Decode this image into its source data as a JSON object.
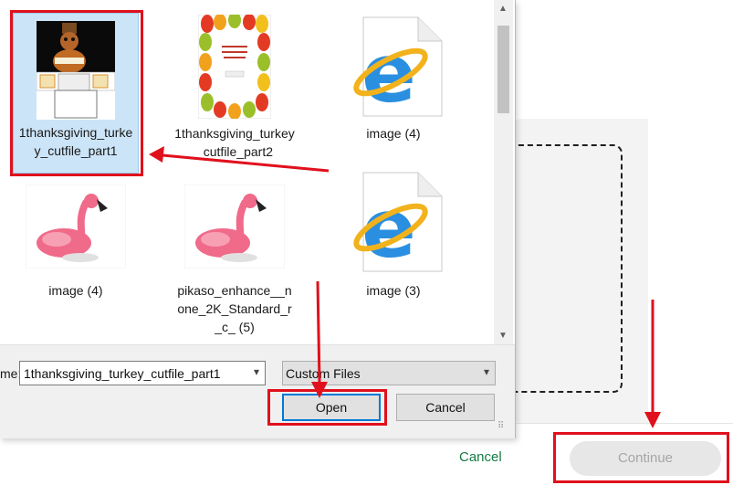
{
  "background": {
    "cancel_label": "Cancel",
    "continue_label": "Continue",
    "accent_color": "#167a45"
  },
  "dialog": {
    "files": [
      {
        "label": "1thanksgiving_turkey_cutfile_part1",
        "icon": "turkey-cutfile-thumbnail",
        "selected": true
      },
      {
        "label": "1thanksgiving_turkey_cutfile_part2",
        "icon": "leaf-wreath-thumbnail",
        "selected": false
      },
      {
        "label": "image (4)",
        "icon": "internet-explorer-file-icon",
        "selected": false
      },
      {
        "label": "image (4)",
        "icon": "flamingo-thumbnail",
        "selected": false
      },
      {
        "label": "pikaso_enhance__none_2K_Standard_r_c_ (5)",
        "icon": "flamingo-thumbnail",
        "selected": false
      },
      {
        "label": "image (3)",
        "icon": "internet-explorer-file-icon",
        "selected": false
      }
    ],
    "file_name_label": "me:",
    "file_name_value": "1thanksgiving_turkey_cutfile_part1",
    "file_type_value": "Custom Files",
    "open_label": "Open",
    "cancel_label": "Cancel"
  },
  "annotation_color": "#e0101c"
}
